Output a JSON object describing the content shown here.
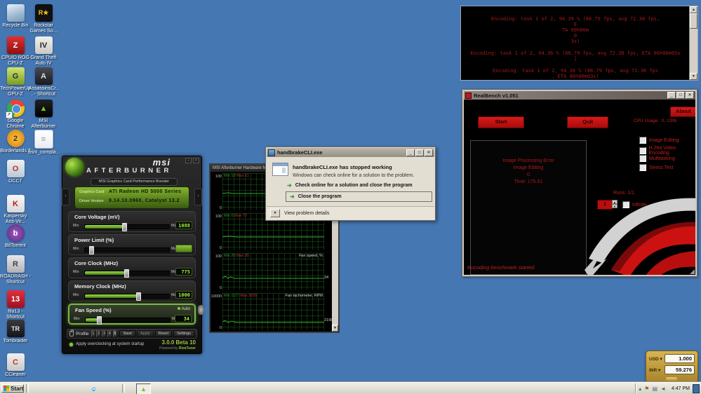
{
  "desktop": {
    "icons": [
      {
        "label": "Recycle Bin",
        "letter": "",
        "style": "background:linear-gradient(160deg,#eaf3fa,#9cb8d0 60%,#7a98b4);color:#345a7a"
      },
      {
        "label": "CPUID ROG CPU-Z",
        "letter": "Z",
        "style": "background:linear-gradient(#e03030,#901010);color:#fff"
      },
      {
        "label": "TechPowerUp GPU-Z",
        "letter": "G",
        "style": "background:linear-gradient(#cfe470,#7a9c20);color:#223344"
      },
      {
        "label": "Google Chrome",
        "letter": "",
        "style": "background:conic-gradient(from -45deg,#ea4335 0 33%,#fbbc05 0 66%,#34a853 0 100%);border-radius:50%"
      },
      {
        "label": "Borderlands 2",
        "letter": "2",
        "style": "background:radial-gradient(#f8c838,#d07818);color:#5a2a08;border-radius:50%"
      },
      {
        "label": "OCCT",
        "letter": "O",
        "style": "background:linear-gradient(#f0f0f0,#b8c8d8);color:#c03018"
      },
      {
        "label": "Kaspersky Anti-Vir...",
        "letter": "K",
        "style": "background:linear-gradient(#f8f8f8,#d8d8d8);color:#c01818"
      },
      {
        "label": "BitTorrent",
        "letter": "b",
        "style": "background:radial-gradient(#9a5abf,#5a2a80);color:#fff;border-radius:50%"
      },
      {
        "label": "ROADRASH - Shortcut",
        "letter": "R",
        "style": "background:linear-gradient(#e8e8e8,#b0b0b8);color:#444"
      },
      {
        "label": "fifa13 - Shortcut",
        "letter": "13",
        "style": "background:linear-gradient(#e03040,#a01020);color:#fff"
      },
      {
        "label": "Tombraider",
        "letter": "TR",
        "style": "background:linear-gradient(#3a3a42,#14141a);color:#e8e8e8;font-size:9px"
      },
      {
        "label": "CCleaner",
        "letter": "C",
        "style": "background:linear-gradient(#f0f0f0,#c8c8c8);color:#d03020"
      },
      {
        "label": "Rockstar Games So...",
        "letter": "R★",
        "style": "background:#101010;color:#f8c020;font-size:9px"
      },
      {
        "label": "Grand Theft Auto IV",
        "letter": "IV",
        "style": "background:linear-gradient(#f0f0ee,#c8c8c4);color:#222"
      },
      {
        "label": "AssassinsCr... - Shortcut",
        "letter": "A",
        "style": "background:linear-gradient(#4a4a52,#1a1a20);color:#ddd"
      },
      {
        "label": "MSI Afterburner",
        "letter": "▲",
        "style": "background:linear-gradient(#222,#000);color:#7ac428"
      },
      {
        "label": "bsnl_compla...",
        "letter": "≡",
        "style": "background:linear-gradient(#ffffff,#e8ecf2);color:#8899aa;border:1px solid #aabbcc"
      }
    ]
  },
  "console": {
    "blocks": [
      [
        "Encoding: task 1 of 2, 94.39 % (86.79 fps, avg 72.38 fps,",
        "E",
        "TA 00h00m",
        "0",
        "3s)"
      ],
      [
        "Encoding: task 1 of 2, 94.36 % (86.79 fps, avg 72.38 fps, ETA 00h00m03s",
        "]"
      ],
      [
        "Encoding: task 1 of 2, 94.38 % (86.79 fps, avg 72.38 fps",
        ", ETA 00h00m03s)"
      ]
    ]
  },
  "realbench": {
    "title": "RealBench v1.051",
    "about_label": "About",
    "start_label": "Start",
    "quit_label": "Quit",
    "cpu_usage": "CPU Usage : 0, 1395",
    "panel_lines": [
      "Image Processing Error",
      "Image Editing",
      "0",
      "Time: 175.91"
    ],
    "checkboxes": [
      "Image Editing",
      "H.264 Video Encoding",
      "Multitasking",
      "Stress Test"
    ],
    "runs_label": "Runs: 1/1",
    "runs_value": "1",
    "infinite_label": "Infinite",
    "status": "Encoding benchmark started",
    "accent_red": "#cc1111"
  },
  "dialog": {
    "title": "handbrakeCLI.exe",
    "heading": "handbrakeCLI.exe has stopped working",
    "body": "Windows can check online for a solution to the problem.",
    "option1": "Check online for a solution and close the program",
    "option2": "Close the program",
    "details_label": "View problem details",
    "min_glyph": "_",
    "max_glyph": "□",
    "close_glyph": "✕"
  },
  "afterburner": {
    "brand": "msi",
    "title": "AFTERBURNER",
    "subtitle": "MSI Graphics Card Performance Booster",
    "gpu_label": "Graphics Card",
    "gpu_value": "ATI Radeon HD 5000 Series",
    "driver_label": "Driver Version",
    "driver_value": "9.14.10.0960, Catalyst 13.2",
    "min_label": "Min",
    "max_label": "Max",
    "auto_label": "Auto",
    "sliders": [
      {
        "name": "Core Voltage (mV)",
        "value": "1088"
      },
      {
        "name": "Power Limit (%)",
        "value": ""
      },
      {
        "name": "Core Clock (MHz)",
        "value": "775"
      },
      {
        "name": "Memory Clock (MHz)",
        "value": "1000"
      },
      {
        "name": "Fan Speed (%)",
        "value": "34"
      }
    ],
    "profile_label": "Profile",
    "profile_buttons": [
      "1",
      "2",
      "3",
      "4",
      "5"
    ],
    "save_label": "Save",
    "apply_label": "Apply",
    "reset_label": "Reset",
    "settings_label": "Settings",
    "startup_label": "Apply overclocking at system startup",
    "version": "3.0.0 Beta 10",
    "powered_prefix": "Powered by ",
    "powered_brand": "RivaTuner",
    "accent_green": "#7ac428"
  },
  "hwmonitor": {
    "title": "MSI Afterburner Hardware Monit",
    "min_label": "Min",
    "max_label": "Max",
    "graphs": [
      {
        "scale_top": "100",
        "scale_bottom": "0",
        "min": "10",
        "max": "11",
        "name": "",
        "value": ""
      },
      {
        "scale_top": "100",
        "scale_bottom": "0",
        "min": "0",
        "max": "77",
        "name": "",
        "value": ""
      },
      {
        "scale_top": "100",
        "scale_bottom": "0",
        "min": "20",
        "max": "35",
        "name": "Fan speed, %",
        "value": "34"
      },
      {
        "scale_top": "10000",
        "scale_bottom": "0",
        "min": "1117",
        "max": "2035",
        "name": "Fan tachometer, RPM",
        "value": "2198"
      }
    ],
    "line_color": "#2ea82e"
  },
  "currency": {
    "rows": [
      {
        "code": "USD",
        "value": "1.000"
      },
      {
        "code": "INR",
        "value": "59.276"
      }
    ],
    "gold": "#c9a43a"
  },
  "taskbar": {
    "start_label": "Start",
    "quicklaunch": [
      {
        "name": "show-desktop-icon",
        "letter": "",
        "style": "background:linear-gradient(135deg,#d8e8f4 50%,#88a8c8 50%)"
      },
      {
        "name": "media-player-icon",
        "letter": "",
        "style": "background:radial-gradient(#f8d080,#e08020);border-radius:50%"
      },
      {
        "name": "firefox-icon",
        "letter": "",
        "style": "background:radial-gradient(#ffd060 20%,#f07820);border-radius:50%"
      },
      {
        "name": "chrome-icon",
        "letter": "",
        "style": "background:conic-gradient(from -45deg,#ea4335 0 33%,#fbbc05 0 66%,#34a853 0 100%);border-radius:50%"
      },
      {
        "name": "media-classic-icon",
        "letter": "",
        "style": "background:#8a1616"
      },
      {
        "name": "skype-icon",
        "letter": "S",
        "style": "background:radial-gradient(#6ac8f0,#1890d0);border-radius:50%;color:#fff"
      },
      {
        "name": "explorer-icon",
        "letter": "",
        "style": "background:linear-gradient(#f0d890,#c8a040)"
      },
      {
        "name": "afterburner-quicklaunch-icon",
        "letter": "",
        "style": "background:linear-gradient(#402020,#181010)"
      },
      {
        "name": "notepad-icon",
        "letter": "",
        "style": "background:linear-gradient(#e8eef4,#b8c4d0)"
      }
    ],
    "active_task_letter": "▲",
    "tray_icons": [
      {
        "name": "tray-expand-icon",
        "glyph": "▴"
      },
      {
        "name": "action-center-flag-icon",
        "glyph": "⚑"
      },
      {
        "name": "network-icon",
        "glyph": "▤"
      },
      {
        "name": "volume-icon",
        "glyph": "◄"
      }
    ],
    "clock": "4:47 PM"
  }
}
